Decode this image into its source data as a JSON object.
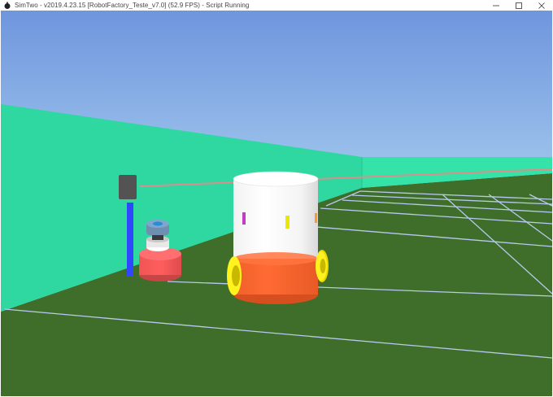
{
  "window": {
    "title": "SimTwo - v2019.4.23.15 [RobotFactory_Teste_v7.0] (52.9 FPS) - Script Running",
    "app_icon": "robot-app-icon",
    "controls": [
      "minimize-icon",
      "maximize-icon",
      "close-icon"
    ]
  },
  "scene": {
    "colors": {
      "sky_top": "#6f95de",
      "sky_bottom": "#b5dcf3",
      "wall": "#2ed8a0",
      "floor": "#3f6e2b",
      "grid": "#b8c8ee",
      "robot_body_top": "#ffffff",
      "robot_body_bottom": "#ff6a33",
      "wheels": "#ffef1f",
      "marker": "#ff9a2a",
      "side_robot": "#ff5a5a",
      "pole": "#2f47ff",
      "beam": "#d9908a"
    }
  }
}
